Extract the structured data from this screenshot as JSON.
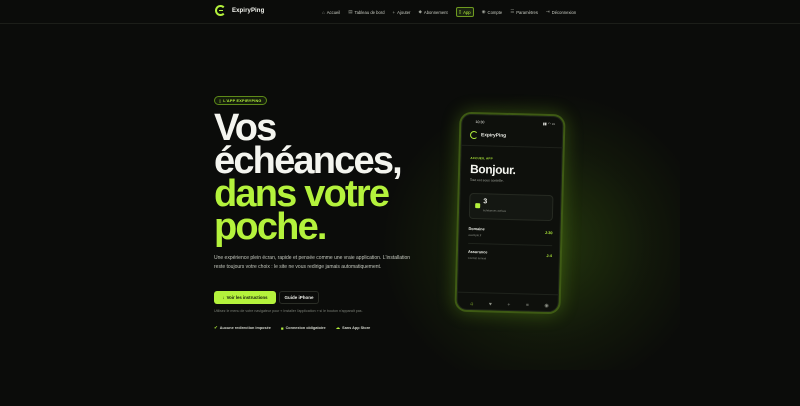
{
  "brand": {
    "name": "ExpiryPing",
    "accent": "#b4f23c"
  },
  "nav": {
    "items": [
      {
        "label": "Accueil",
        "icon": "home-icon",
        "glyph": "⌂"
      },
      {
        "label": "Tableau de bord",
        "icon": "dashboard-icon",
        "glyph": "▤"
      },
      {
        "label": "Ajouter",
        "icon": "plus-icon",
        "glyph": "+"
      },
      {
        "label": "Abonnement",
        "icon": "diamond-icon",
        "glyph": "◆"
      },
      {
        "label": "App",
        "icon": "phone-icon",
        "glyph": "▯",
        "active": true
      },
      {
        "label": "Compte",
        "icon": "user-icon",
        "glyph": "◉"
      },
      {
        "label": "Paramètres",
        "icon": "settings-icon",
        "glyph": "☰"
      },
      {
        "label": "Déconnexion",
        "icon": "logout-icon",
        "glyph": "⇥"
      }
    ]
  },
  "hero": {
    "badge": "L'APP EXPIRYPING",
    "headline_white_1": "Vos",
    "headline_white_2": "échéances,",
    "headline_green_1": "dans votre",
    "headline_green_2": "poche.",
    "description": "Une expérience plein écran, rapide et pensée comme une vraie application. L'installation reste toujours votre choix : le site ne vous redirige jamais automatiquement.",
    "primary_button": "Voir les instructions",
    "secondary_button": "Guide iPhone",
    "hint": "Utilisez le menu de votre navigateur pour « Installer l'application » si le bouton n'apparaît pas.",
    "features": [
      {
        "label": "Aucune redirection imposée",
        "icon": "check-circle-icon",
        "glyph": "✔"
      },
      {
        "label": "Connexion obligatoire",
        "icon": "lock-icon",
        "glyph": "■"
      },
      {
        "label": "Sans App Store",
        "icon": "cloud-icon",
        "glyph": "☁"
      }
    ]
  },
  "phone": {
    "time": "10:30",
    "status_icons": "▮▮ ◠ ▭",
    "app_name": "ExpiryPing",
    "kicker": "ACCUEIL APP",
    "greeting": "Bonjour.",
    "subtitle": "Tout est sous contrôle.",
    "card_count": "3",
    "card_label": "échéances actives",
    "rows": [
      {
        "title": "Domaine",
        "sub": "exemple.fr",
        "value": "J-30"
      },
      {
        "title": "Assurance",
        "sub": "Contrat annuel",
        "value": "J-4"
      }
    ],
    "tabs": [
      {
        "icon": "home-icon",
        "glyph": "⌂",
        "active": true
      },
      {
        "icon": "heart-icon",
        "glyph": "♥"
      },
      {
        "icon": "plus-icon",
        "glyph": "+"
      },
      {
        "icon": "list-icon",
        "glyph": "≡"
      },
      {
        "icon": "user-icon",
        "glyph": "◉"
      }
    ]
  }
}
